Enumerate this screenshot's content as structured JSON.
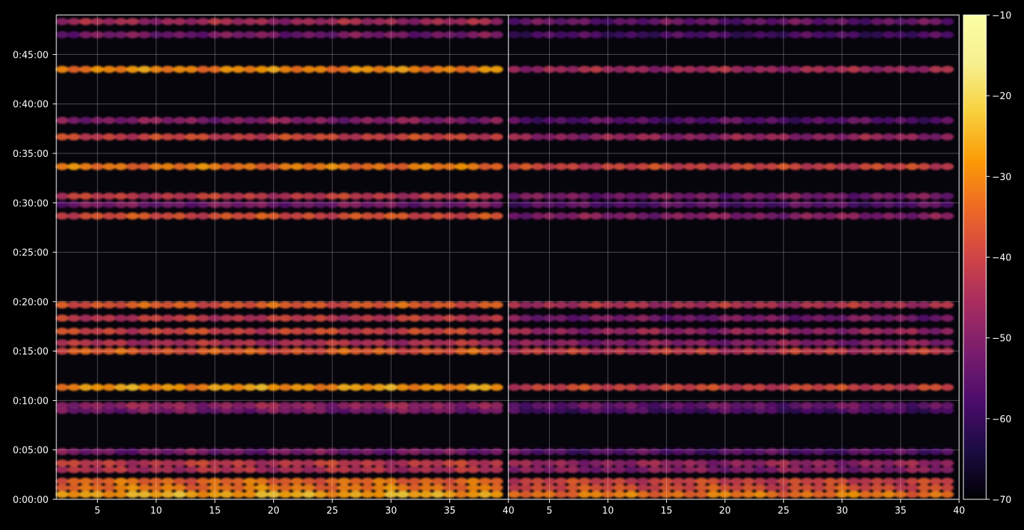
{
  "chart_data": {
    "type": "heatmap",
    "title": "",
    "xlabel": "",
    "ylabel": "",
    "background": "#000000",
    "grid": true,
    "legend": "colorbar-right",
    "colormap": "inferno",
    "panels": [
      {
        "x_range": [
          1.5,
          40
        ],
        "x_ticks": [
          5,
          10,
          15,
          20,
          25,
          30,
          35,
          40
        ],
        "x_tick_labels": [
          "5",
          "10",
          "15",
          "20",
          "25",
          "30",
          "35",
          "40"
        ]
      },
      {
        "x_range": [
          1.5,
          40
        ],
        "x_ticks": [
          5,
          10,
          15,
          20,
          25,
          30,
          35,
          40
        ],
        "x_tick_labels": [
          "5",
          "10",
          "15",
          "20",
          "25",
          "30",
          "35",
          "40"
        ]
      }
    ],
    "y_range_seconds": [
      0,
      2940
    ],
    "y_ticks_seconds": [
      0,
      300,
      600,
      900,
      1200,
      1500,
      1800,
      2100,
      2400,
      2700
    ],
    "y_tick_labels": [
      "0:00:00",
      "0:05:00",
      "0:10:00",
      "0:15:00",
      "0:20:00",
      "0:25:00",
      "0:30:00",
      "0:35:00",
      "0:40:00",
      "0:45:00"
    ],
    "colorbar": {
      "range": [
        -70,
        -10
      ],
      "ticks": [
        -70,
        -60,
        -50,
        -40,
        -30,
        -20,
        -10
      ],
      "tick_labels": [
        "−70",
        "−60",
        "−50",
        "−40",
        "−30",
        "−20",
        "−10"
      ]
    },
    "bands": [
      {
        "time": "0:00:30",
        "left": -26,
        "right": -32
      },
      {
        "time": "0:01:10",
        "left": -32,
        "right": -38
      },
      {
        "time": "0:01:50",
        "left": -34,
        "right": -40
      },
      {
        "time": "0:03:00",
        "left": -44,
        "right": -50
      },
      {
        "time": "0:03:40",
        "left": -42,
        "right": -48
      },
      {
        "time": "0:04:50",
        "left": -52,
        "right": -56
      },
      {
        "time": "0:09:00",
        "left": -52,
        "right": -58
      },
      {
        "time": "0:09:30",
        "left": -48,
        "right": -54
      },
      {
        "time": "0:11:20",
        "left": -28,
        "right": -40
      },
      {
        "time": "0:15:00",
        "left": -36,
        "right": -42
      },
      {
        "time": "0:15:50",
        "left": -44,
        "right": -50
      },
      {
        "time": "0:17:00",
        "left": -40,
        "right": -48
      },
      {
        "time": "0:18:20",
        "left": -42,
        "right": -52
      },
      {
        "time": "0:19:40",
        "left": -36,
        "right": -44
      },
      {
        "time": "0:28:40",
        "left": -38,
        "right": -50
      },
      {
        "time": "0:29:50",
        "left": -52,
        "right": -56
      },
      {
        "time": "0:30:40",
        "left": -42,
        "right": -52
      },
      {
        "time": "0:33:40",
        "left": -32,
        "right": -40
      },
      {
        "time": "0:36:40",
        "left": -40,
        "right": -48
      },
      {
        "time": "0:38:20",
        "left": -50,
        "right": -56
      },
      {
        "time": "0:43:30",
        "left": -30,
        "right": -46
      },
      {
        "time": "0:47:00",
        "left": -52,
        "right": -58
      },
      {
        "time": "0:48:20",
        "left": -46,
        "right": -54
      }
    ]
  }
}
